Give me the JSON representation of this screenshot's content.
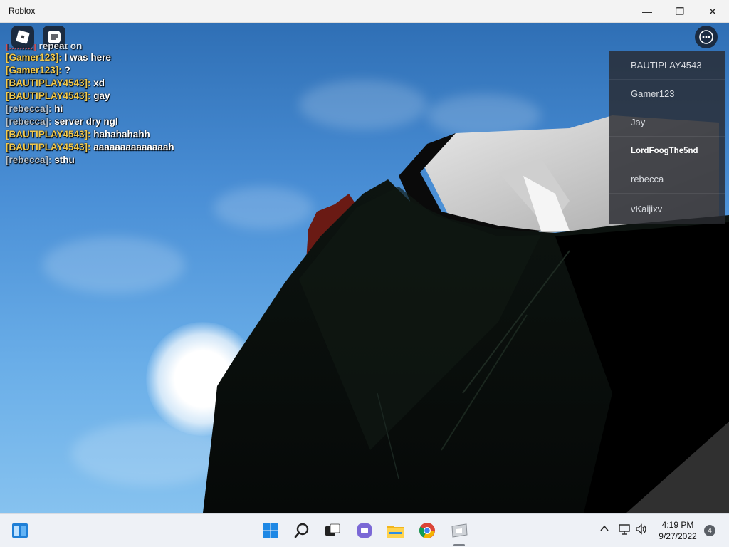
{
  "window": {
    "title": "Roblox",
    "minimize_glyph": "—",
    "maximize_glyph": "❐",
    "close_glyph": "✕"
  },
  "hud": {
    "logo_icon": "roblox-logo-icon",
    "chat_icon": "chat-icon",
    "menu_icon": "more-options-icon"
  },
  "chat": {
    "partial_line": "repeat on",
    "messages": [
      {
        "name": "[Gamer123]:",
        "text": "I was here",
        "color": "#f2c94c"
      },
      {
        "name": "[Gamer123]:",
        "text": "?",
        "color": "#f2c94c"
      },
      {
        "name": "[BAUTIPLAY4543]:",
        "text": "xd",
        "color": "#f2c94c"
      },
      {
        "name": "[BAUTIPLAY4543]:",
        "text": "gay",
        "color": "#f2c94c"
      },
      {
        "name": "[rebecca]:",
        "text": "hi",
        "color": "#b8c2cc"
      },
      {
        "name": "[rebecca]:",
        "text": "server dry ngl",
        "color": "#b8c2cc"
      },
      {
        "name": "[BAUTIPLAY4543]:",
        "text": "hahahahahh",
        "color": "#f2c94c"
      },
      {
        "name": "[BAUTIPLAY4543]:",
        "text": "aaaaaaaaaaaaaah",
        "color": "#f2c94c"
      },
      {
        "name": "[rebecca]:",
        "text": "sthu",
        "color": "#b8c2cc"
      }
    ]
  },
  "playerlist": {
    "players": [
      "BAUTIPLAY4543",
      "Gamer123",
      "Jay",
      "LordFoogThe5nd",
      "rebecca",
      "vKaijixv"
    ],
    "local_player": "LordFoogThe5nd"
  },
  "taskbar": {
    "icons": [
      "widgets-icon",
      "windows-start-icon",
      "search-icon",
      "task-view-icon",
      "teams-chat-icon",
      "file-explorer-icon",
      "chrome-icon",
      "roblox-taskbar-icon"
    ],
    "time": "4:19 PM",
    "date": "9/27/2022",
    "notification_count": "4"
  }
}
